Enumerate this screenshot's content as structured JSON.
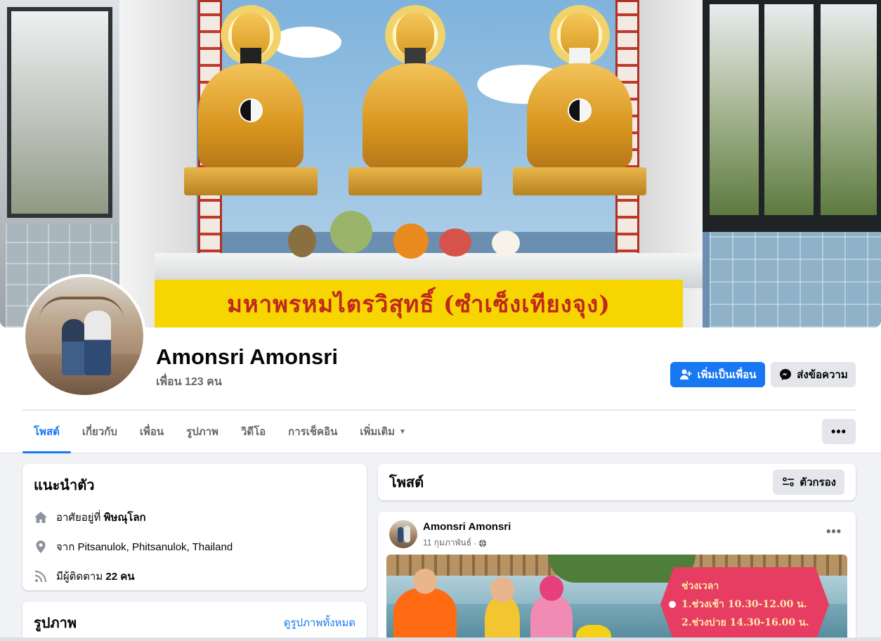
{
  "cover": {
    "banner_text": "มหาพรหมไตรวิสุทธิ์ (ซำเซ็งเทียงจุง)"
  },
  "profile": {
    "name": "Amonsri Amonsri",
    "friends": "เพื่อน 123 คน",
    "add_friend_label": "เพิ่มเป็นเพื่อน",
    "message_label": "ส่งข้อความ"
  },
  "tabs": [
    {
      "label": "โพสต์",
      "active": true
    },
    {
      "label": "เกี่ยวกับ"
    },
    {
      "label": "เพื่อน"
    },
    {
      "label": "รูปภาพ"
    },
    {
      "label": "วิดีโอ"
    },
    {
      "label": "การเช็คอิน"
    },
    {
      "label": "เพิ่มเติม"
    }
  ],
  "more_button": "•••",
  "intro": {
    "title": "แนะนำตัว",
    "lives_prefix": "อาศัยอยู่ที่",
    "lives_value": "พิษณุโลก",
    "from": "จาก Pitsanulok, Phitsanulok, Thailand",
    "followers_prefix": "มีผู้ติดตาม",
    "followers_value": "22 คน"
  },
  "photos": {
    "title": "รูปภาพ",
    "see_all": "ดูรูปภาพทั้งหมด"
  },
  "posts": {
    "title": "โพสต์",
    "filter_label": "ตัวกรอง"
  },
  "post": {
    "author": "Amonsri Amonsri",
    "date": "11 กุมภาพันธ์",
    "more": "•••",
    "image_text": {
      "title": "ช่วงเวลา",
      "line1": "1.ช่วงเช้า 10.30-12.00 น.",
      "line2": "2.ช่วงบ่าย 14.30-16.00 น."
    }
  },
  "colors": {
    "primary": "#1877f2",
    "background": "#f0f2f5",
    "secondary_button": "#e4e6eb",
    "secondary_text": "#65676b"
  },
  "icons": [
    "add-friend-icon",
    "messenger-icon",
    "home-icon",
    "location-pin-icon",
    "rss-followers-icon",
    "filter-icon",
    "globe-icon",
    "caret-down-icon"
  ]
}
